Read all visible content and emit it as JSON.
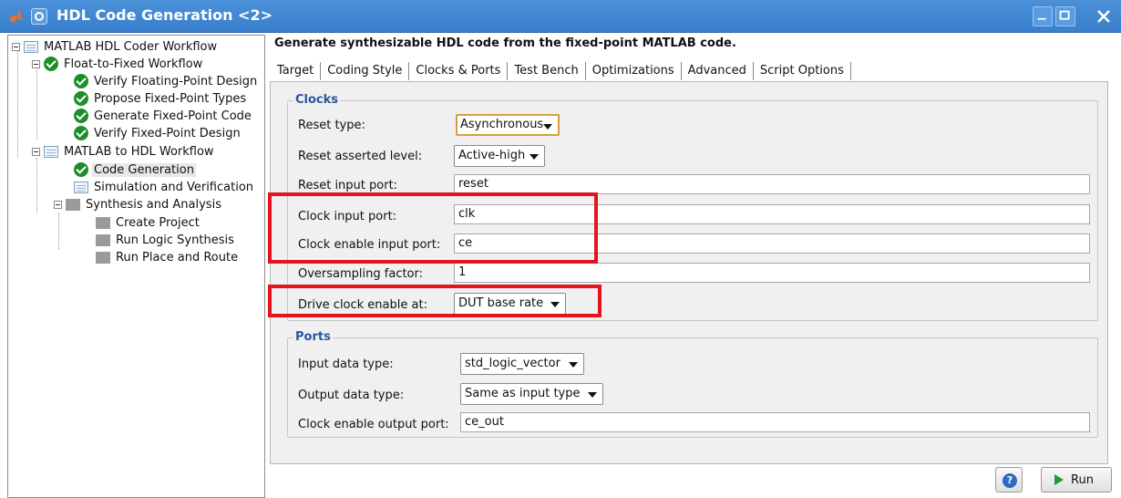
{
  "window": {
    "title": "HDL Code Generation  <2>"
  },
  "tree": {
    "root": "MATLAB HDL Coder Workflow",
    "float_to_fixed": "Float-to-Fixed Workflow",
    "verify_floating": "Verify Floating-Point Design",
    "propose_types": "Propose Fixed-Point Types",
    "generate_fixed": "Generate Fixed-Point Code",
    "verify_fixed": "Verify Fixed-Point Design",
    "matlab_to_hdl": "MATLAB to HDL Workflow",
    "code_generation": "Code Generation",
    "sim_verify": "Simulation and Verification",
    "synthesis": "Synthesis and Analysis",
    "create_project": "Create Project",
    "run_logic": "Run Logic Synthesis",
    "run_place": "Run Place and Route"
  },
  "main": {
    "heading": "Generate synthesizable HDL code from the fixed-point MATLAB code.",
    "tabs": [
      "Target",
      "Coding Style",
      "Clocks & Ports",
      "Test Bench",
      "Optimizations",
      "Advanced",
      "Script Options"
    ],
    "active_tab": "Clocks & Ports"
  },
  "clocks": {
    "title": "Clocks",
    "reset_type_label": "Reset type:",
    "reset_type_value": "Asynchronous",
    "reset_level_label": "Reset asserted level:",
    "reset_level_value": "Active-high",
    "reset_port_label": "Reset input port:",
    "reset_port_value": "reset",
    "clock_port_label": "Clock input port:",
    "clock_port_value": "clk",
    "clock_enable_label": "Clock enable input port:",
    "clock_enable_value": "ce",
    "oversampling_label": "Oversampling factor:",
    "oversampling_value": "1",
    "drive_label": "Drive clock enable at:",
    "drive_value": "DUT base rate"
  },
  "ports": {
    "title": "Ports",
    "input_type_label": "Input data type:",
    "input_type_value": "std_logic_vector",
    "output_type_label": "Output data type:",
    "output_type_value": "Same as input type",
    "ce_out_label": "Clock enable output port:",
    "ce_out_value": "ce_out"
  },
  "buttons": {
    "help": "?",
    "run": "Run"
  },
  "colors": {
    "titlebar": "#3a7fcc",
    "highlight": "#e3141f",
    "group_title": "#2a55a0",
    "run_icon": "#1f9a2f"
  }
}
